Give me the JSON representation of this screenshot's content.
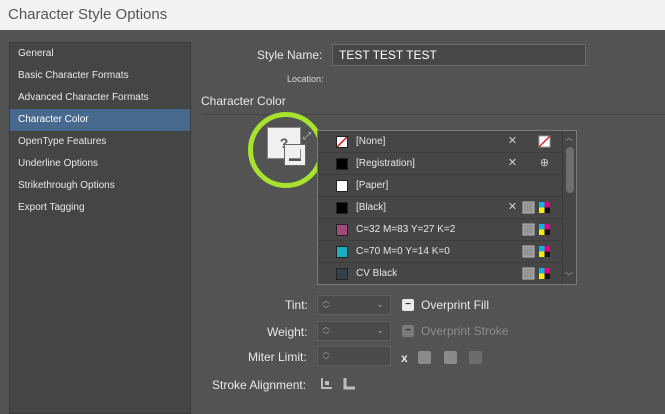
{
  "window": {
    "title": "Character Style Options"
  },
  "sidebar": {
    "items": [
      {
        "label": "General"
      },
      {
        "label": "Basic Character Formats"
      },
      {
        "label": "Advanced Character Formats"
      },
      {
        "label": "Character Color",
        "active": true
      },
      {
        "label": "OpenType Features"
      },
      {
        "label": "Underline Options"
      },
      {
        "label": "Strikethrough Options"
      },
      {
        "label": "Export Tagging"
      }
    ]
  },
  "header": {
    "style_name_label": "Style Name:",
    "style_name_value": "TEST TEST TEST",
    "location_label": "Location:"
  },
  "section": {
    "title": "Character Color"
  },
  "proxy": {
    "fill_glyph": "?"
  },
  "swatches": [
    {
      "name": "[None]",
      "color": "#ffffff",
      "none": true,
      "icons": [
        "no-edit-icon",
        "none-swatch-icon"
      ]
    },
    {
      "name": "[Registration]",
      "color": "#000000",
      "icons": [
        "no-edit-icon",
        "registration-icon"
      ]
    },
    {
      "name": "[Paper]",
      "color": "#ffffff",
      "icons": []
    },
    {
      "name": "[Black]",
      "color": "#000000",
      "icons": [
        "no-edit-icon",
        "process-icon",
        "cmyk-icon"
      ]
    },
    {
      "name": "C=32 M=83 Y=27 K=2",
      "color": "#a3487a",
      "icons": [
        "process-icon",
        "cmyk-icon"
      ]
    },
    {
      "name": "C=70 M=0 Y=14 K=0",
      "color": "#1aaec6",
      "icons": [
        "process-icon",
        "cmyk-icon"
      ]
    },
    {
      "name": "CV Black",
      "color": "#35404a",
      "icons": [
        "process-icon",
        "cmyk-icon"
      ]
    }
  ],
  "stroke": {
    "tint_label": "Tint:",
    "weight_label": "Weight:",
    "miter_label": "Miter Limit:",
    "miter_x": "x",
    "alignment_label": "Stroke Alignment:",
    "overprint_fill_label": "Overprint Fill",
    "overprint_stroke_label": "Overprint Stroke"
  }
}
